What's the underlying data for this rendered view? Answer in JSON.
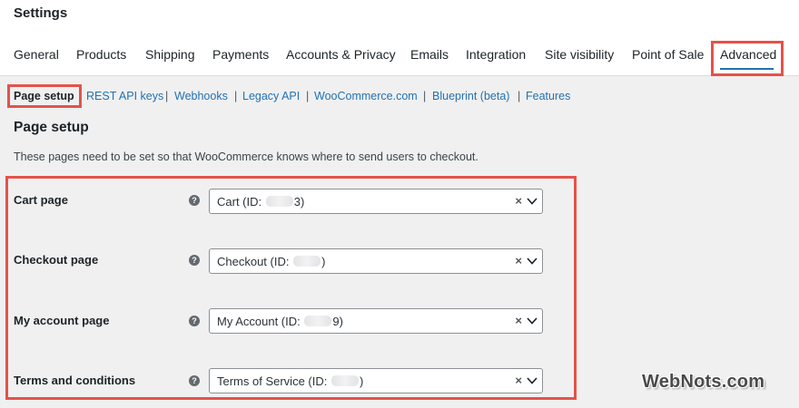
{
  "header": {
    "title": "Settings"
  },
  "tabs": [
    {
      "label": "General"
    },
    {
      "label": "Products"
    },
    {
      "label": "Shipping"
    },
    {
      "label": "Payments"
    },
    {
      "label": "Accounts & Privacy"
    },
    {
      "label": "Emails"
    },
    {
      "label": "Integration"
    },
    {
      "label": "Site visibility"
    },
    {
      "label": "Point of Sale"
    },
    {
      "label": "Advanced",
      "active": true
    }
  ],
  "subnav": {
    "items": [
      {
        "label": "Page setup",
        "current": true
      },
      {
        "label": "REST API keys"
      },
      {
        "label": "Webhooks"
      },
      {
        "label": "Legacy API"
      },
      {
        "label": "WooCommerce.com"
      },
      {
        "label": "Blueprint (beta)"
      },
      {
        "label": "Features"
      }
    ],
    "separator": "|"
  },
  "section": {
    "title": "Page setup",
    "description": "These pages need to be set so that WooCommerce knows where to send users to checkout."
  },
  "fields": [
    {
      "label": "Cart page",
      "value_prefix": "Cart (ID: ",
      "value_suffix": "3)"
    },
    {
      "label": "Checkout page",
      "value_prefix": "Checkout (ID: ",
      "value_suffix": ")"
    },
    {
      "label": "My account page",
      "value_prefix": "My Account (ID: ",
      "value_suffix": "9)"
    },
    {
      "label": "Terms and conditions",
      "value_prefix": "Terms of Service (ID: ",
      "value_suffix": ")"
    }
  ],
  "icons": {
    "help": "question-circle-icon",
    "clear": "clear-x-icon",
    "dropdown": "chevron-down-icon"
  },
  "glyphs": {
    "help": "?",
    "clear": "×"
  },
  "watermark": "WebNots.com",
  "colors": {
    "link": "#2271b1",
    "highlight": "#e5524a",
    "text": "#1d2327",
    "background": "#f0f0f1"
  }
}
